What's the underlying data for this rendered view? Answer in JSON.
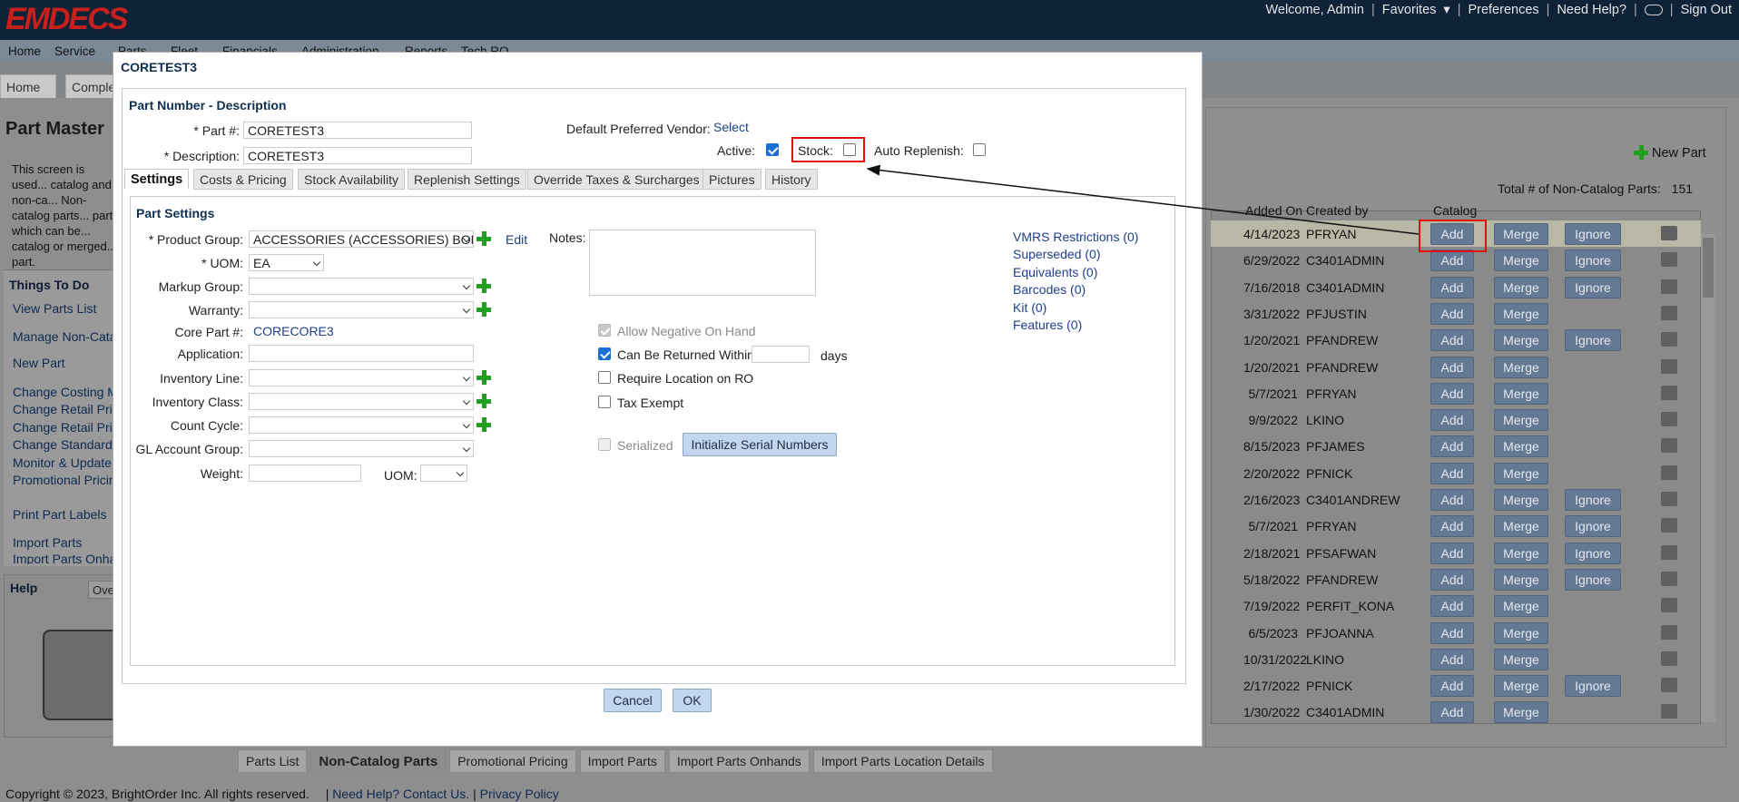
{
  "header": {
    "logo": "EMDECS",
    "welcome": "Welcome, Admin",
    "favorites": "Favorites",
    "preferences": "Preferences",
    "need_help": "Need Help?",
    "sign_out": "Sign Out"
  },
  "mainnav": [
    "Home",
    "Service",
    "Parts",
    "Fleet",
    "Financials",
    "Administration",
    "Reports",
    "Tech RO"
  ],
  "app_tabs": [
    "Home",
    "Comple"
  ],
  "left": {
    "title": "Part Master",
    "description": "This screen is used... catalog and non-ca... Non-catalog parts... parts which can be... catalog or merged... part.",
    "things_to_do": "Things To Do",
    "links": [
      "View Parts List",
      "Manage Non-Catal",
      "New Part",
      "Change Costing M",
      "Change Retail Pric",
      "Change Retail Pric",
      "Change Standard",
      "Monitor & Update",
      "Promotional Pricin",
      "Print Part Labels",
      "Import Parts",
      "Import Parts Onha"
    ],
    "help_title": "Help",
    "help_tab": "Ove"
  },
  "grid": {
    "new_part": "New Part",
    "total": "Total # of Non-Catalog Parts:",
    "total_value": "151",
    "headers": {
      "added_on": "Added On",
      "created_by": "Created by",
      "catalog": "Catalog"
    },
    "buttons": {
      "add": "Add",
      "merge": "Merge",
      "ignore": "Ignore"
    },
    "rows": [
      {
        "date": "4/14/2023",
        "user": "PFRYAN",
        "ignore": true
      },
      {
        "date": "6/29/2022",
        "user": "C3401ADMIN",
        "ignore": true
      },
      {
        "date": "7/16/2018",
        "user": "C3401ADMIN",
        "ignore": true
      },
      {
        "date": "3/31/2022",
        "user": "PFJUSTIN",
        "ignore": false
      },
      {
        "date": "1/20/2021",
        "user": "PFANDREW",
        "ignore": true
      },
      {
        "date": "1/20/2021",
        "user": "PFANDREW",
        "ignore": false
      },
      {
        "date": "5/7/2021",
        "user": "PFRYAN",
        "ignore": false
      },
      {
        "date": "9/9/2022",
        "user": "LKINO",
        "ignore": false
      },
      {
        "date": "8/15/2023",
        "user": "PFJAMES",
        "ignore": false
      },
      {
        "date": "2/20/2022",
        "user": "PFNICK",
        "ignore": false
      },
      {
        "date": "2/16/2023",
        "user": "C3401ANDREW",
        "ignore": true
      },
      {
        "date": "5/7/2021",
        "user": "PFRYAN",
        "ignore": true
      },
      {
        "date": "2/18/2021",
        "user": "PFSAFWAN",
        "ignore": true
      },
      {
        "date": "5/18/2022",
        "user": "PFANDREW",
        "ignore": true
      },
      {
        "date": "7/19/2022",
        "user": "PERFIT_KONA",
        "ignore": false
      },
      {
        "date": "6/5/2023",
        "user": "PFJOANNA",
        "ignore": false
      },
      {
        "date": "10/31/2022",
        "user": "LKINO",
        "ignore": false
      },
      {
        "date": "2/17/2022",
        "user": "PFNICK",
        "ignore": true
      },
      {
        "date": "1/30/2022",
        "user": "C3401ADMIN",
        "ignore": false
      }
    ]
  },
  "bottom_tabs": [
    "Parts List",
    "Non-Catalog Parts",
    "Promotional Pricing",
    "Import Parts",
    "Import Parts Onhands",
    "Import Parts Location Details"
  ],
  "footer": {
    "copyright": "Copyright © 2023, BrightOrder Inc. All rights reserved.",
    "help": "Need Help? Contact Us.",
    "privacy": "Privacy Policy"
  },
  "modal": {
    "title": "CORETEST3",
    "section": "Part Number - Description",
    "part_label": "* Part #:",
    "part_value": "CORETEST3",
    "desc_label": "* Description:",
    "desc_value": "CORETEST3",
    "vendor_label": "Default Preferred Vendor:",
    "vendor_link": "Select",
    "active_label": "Active:",
    "stock_label": "Stock:",
    "auto_label": "Auto Replenish:",
    "tabs": [
      "Settings",
      "Costs & Pricing",
      "Stock Availability",
      "Replenish Settings",
      "Override Taxes & Surcharges",
      "Pictures",
      "History"
    ],
    "settings": {
      "title": "Part Settings",
      "product_group_label": "* Product Group:",
      "product_group_value": "ACCESSORIES (ACCESSORIES) BODY",
      "edit": "Edit",
      "uom_label": "* UOM:",
      "uom_value": "EA",
      "markup_label": "Markup Group:",
      "warranty_label": "Warranty:",
      "core_label": "Core Part #:",
      "core_value": "CORECORE3",
      "application_label": "Application:",
      "inv_line_label": "Inventory Line:",
      "inv_class_label": "Inventory Class:",
      "count_label": "Count Cycle:",
      "gl_label": "GL Account Group:",
      "weight_label": "Weight:",
      "uom2_label": "UOM:",
      "notes_label": "Notes:",
      "allow_neg": "Allow Negative On Hand",
      "can_return": "Can Be Returned Within",
      "days": "days",
      "require_loc": "Require Location on RO",
      "tax_exempt": "Tax Exempt",
      "serialized": "Serialized",
      "init_serial": "Initialize Serial Numbers",
      "right_links": [
        "VMRS Restrictions (0)",
        "Superseded (0)",
        "Equivalents (0)",
        "Barcodes (0)",
        "Kit (0)",
        "Features (0)"
      ]
    },
    "cancel": "Cancel",
    "ok": "OK"
  },
  "colors": {
    "header": "#0e2238",
    "logo": "#c8201c",
    "accent": "#1f9e1f",
    "highlight": "#e01010"
  }
}
